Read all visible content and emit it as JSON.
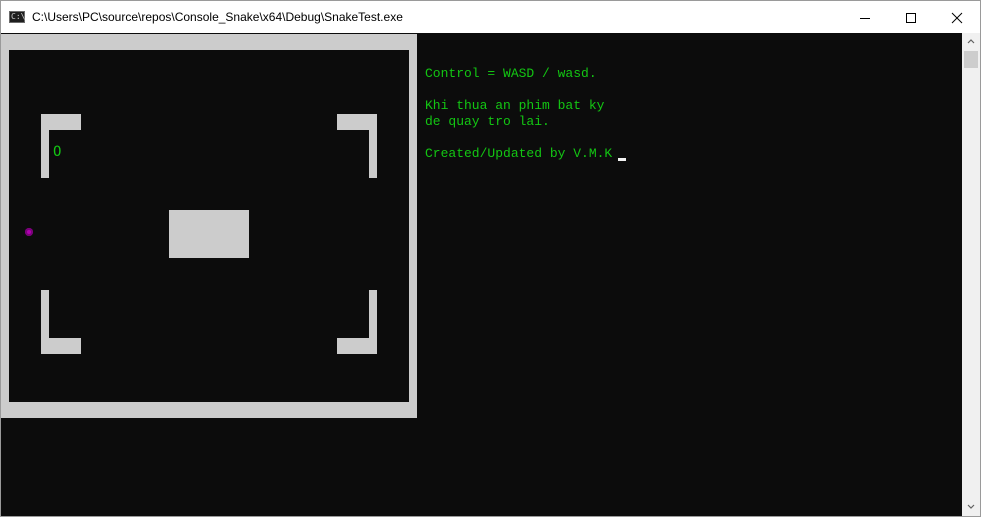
{
  "window": {
    "title": "C:\\Users\\PC\\source\\repos\\Console_Snake\\x64\\Debug\\SnakeTest.exe",
    "icon": "console-app-icon",
    "icon_glyph": "C:\\"
  },
  "controls": {
    "minimize": "minimize-icon",
    "maximize": "maximize-icon",
    "close": "close-icon"
  },
  "game": {
    "food_char": "O",
    "snake_head_color": "#b000b0",
    "wall_color": "#cccccc",
    "background_color": "#0c0c0c"
  },
  "info": {
    "line1": "Control = WASD / wasd.",
    "line2": "Khi thua an phim bat ky",
    "line3": "de quay tro lai.",
    "line4": "Created/Updated by V.M.K",
    "text_color": "#13c613"
  }
}
